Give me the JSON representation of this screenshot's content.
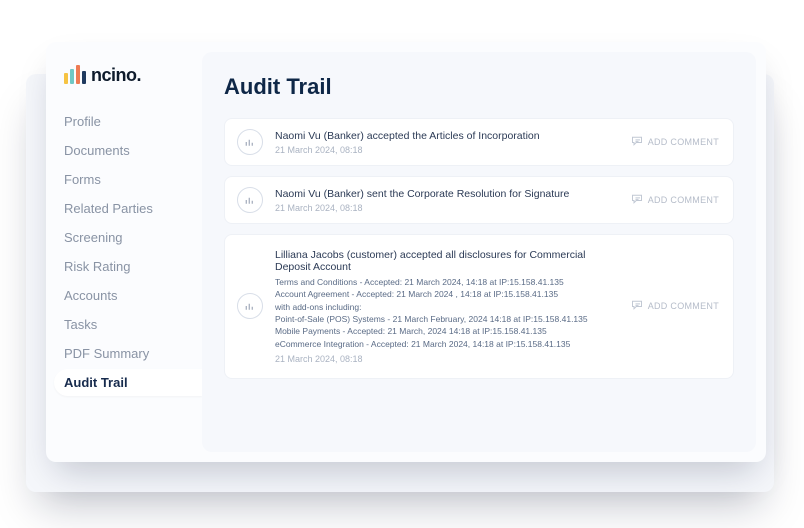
{
  "brand": {
    "name": "ncino",
    "dot": "."
  },
  "sidebar": {
    "items": [
      {
        "label": "Profile",
        "active": false
      },
      {
        "label": "Documents",
        "active": false
      },
      {
        "label": "Forms",
        "active": false
      },
      {
        "label": "Related Parties",
        "active": false
      },
      {
        "label": "Screening",
        "active": false
      },
      {
        "label": "Risk Rating",
        "active": false
      },
      {
        "label": "Accounts",
        "active": false
      },
      {
        "label": "Tasks",
        "active": false
      },
      {
        "label": "PDF Summary",
        "active": false
      },
      {
        "label": "Audit Trail",
        "active": true
      }
    ]
  },
  "main": {
    "title": "Audit Trail",
    "add_comment_label": "ADD COMMENT",
    "entries": [
      {
        "title": "Naomi Vu (Banker) accepted the Articles of Incorporation",
        "details": [],
        "timestamp": "21 March 2024, 08:18"
      },
      {
        "title": "Naomi Vu (Banker) sent the Corporate Resolution for Signature",
        "details": [],
        "timestamp": "21 March 2024, 08:18"
      },
      {
        "title": "Lilliana Jacobs (customer) accepted all disclosures for Commercial Deposit Account",
        "details": [
          "Terms and Conditions - Accepted: 21 March 2024, 14:18 at IP:15.158.41.135",
          "Account Agreement - Accepted: 21 March 2024 , 14:18 at IP:15.158.41.135",
          "with add-ons including:",
          "Point-of-Sale (POS) Systems - 21 March February, 2024 14:18 at IP:15.158.41.135",
          "Mobile Payments - Accepted: 21 March, 2024 14:18 at IP:15.158.41.135",
          "eCommerce Integration - Accepted: 21 March 2024, 14:18 at IP:15.158.41.135"
        ],
        "timestamp": "21 March 2024, 08:18"
      }
    ]
  }
}
